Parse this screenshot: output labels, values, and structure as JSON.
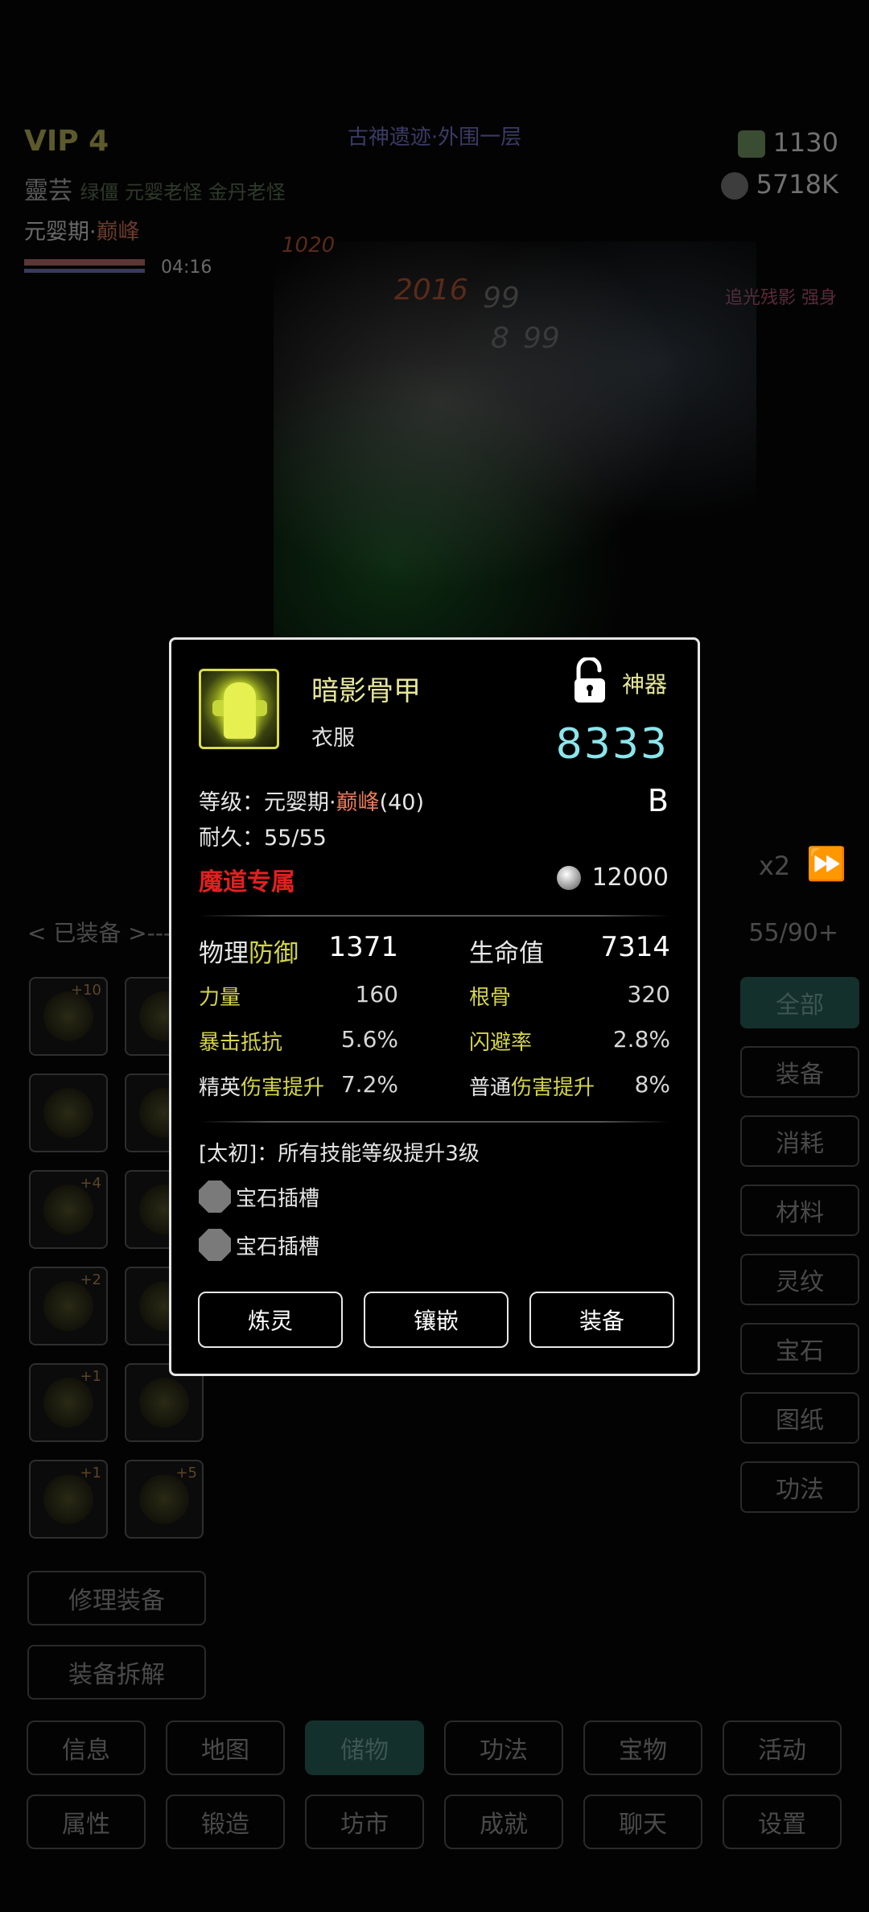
{
  "hud": {
    "vip": "VIP 4",
    "location": "古神遗迹·外围一层",
    "resource_1": "1130",
    "resource_2": "5718K",
    "player_name": "靈芸",
    "player_tags": "绿僵 元婴老怪 金丹老怪",
    "realm_prefix": "元婴期·",
    "realm_stage": "巅峰",
    "timer": "04:16",
    "boss_tag": "追光残影 强身"
  },
  "battle": {
    "damage_numbers": [
      "2016",
      "99",
      "8",
      "99",
      "1020"
    ]
  },
  "inventory": {
    "equipped_label": "< 已装备 >---",
    "bag_count": "55/90+",
    "speed_label": "x2",
    "slots": [
      {
        "plus": "+10"
      },
      {
        "plus": ""
      },
      {
        "plus": ""
      },
      {
        "plus": ""
      },
      {
        "plus": "+4"
      },
      {
        "plus": ""
      },
      {
        "plus": "+2"
      },
      {
        "plus": ""
      },
      {
        "plus": "+1"
      },
      {
        "plus": ""
      },
      {
        "plus": "+1"
      },
      {
        "plus": "+5"
      }
    ],
    "categories": [
      "全部",
      "装备",
      "消耗",
      "材料",
      "灵纹",
      "宝石",
      "图纸",
      "功法"
    ],
    "repair_button": "修理装备",
    "dismantle_button": "装备拆解"
  },
  "nav": {
    "row1": [
      "信息",
      "地图",
      "储物",
      "功法",
      "宝物",
      "活动"
    ],
    "row2": [
      "属性",
      "锻造",
      "坊市",
      "成就",
      "聊天",
      "设置"
    ]
  },
  "dialog": {
    "name": "暗影骨甲",
    "type": "衣服",
    "rarity": "神器",
    "score": "8333",
    "grade": "B",
    "level_prefix": "等级：元婴期·",
    "level_stage": "巅峰",
    "level_num": "(40)",
    "durability": "耐久：55/55",
    "faction": "魔道专属",
    "price": "12000",
    "main_stats": [
      {
        "label_a": "物理",
        "label_b": "防御",
        "value": "1371"
      },
      {
        "label_a": "生命值",
        "label_b": "",
        "value": "7314"
      }
    ],
    "sub_stats": [
      {
        "label_a": "",
        "label_b": "力量",
        "value": "160"
      },
      {
        "label_a": "",
        "label_b": "根骨",
        "value": "320"
      },
      {
        "label_a": "",
        "label_b": "暴击抵抗",
        "value": "5.6%"
      },
      {
        "label_a": "",
        "label_b": "闪避率",
        "value": "2.8%"
      },
      {
        "label_a": "精英",
        "label_b": "伤害提升",
        "value": "7.2%"
      },
      {
        "label_a": "普通",
        "label_b": "伤害提升",
        "value": "8%"
      }
    ],
    "affix": "[太初]：所有技能等级提升3级",
    "gem_slots": [
      "宝石插槽",
      "宝石插槽"
    ],
    "buttons": [
      "炼灵",
      "镶嵌",
      "装备"
    ]
  },
  "colors": {
    "accent_yellow": "#d4d44a",
    "score_cyan": "#8be6ec",
    "faction_red": "#e02020",
    "stage_orange": "#e87a5a"
  }
}
